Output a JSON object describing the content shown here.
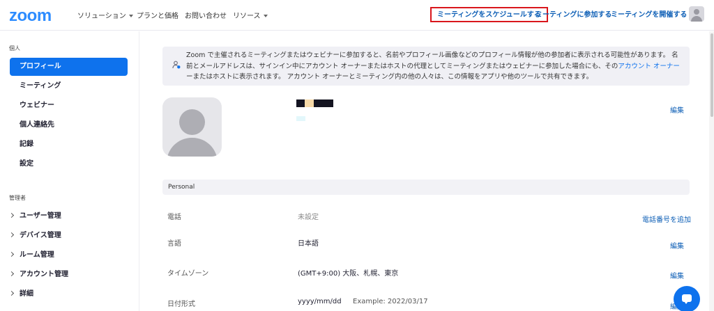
{
  "header": {
    "logo": "zoom",
    "nav": [
      {
        "label": "ソリューション"
      },
      {
        "label": "プランと価格"
      },
      {
        "label": "お問い合わせ"
      },
      {
        "label": "リソース"
      }
    ],
    "schedule_meeting": "ミーティングをスケジュールする",
    "join_meeting": "ミーティングに参加する",
    "host_meeting": "ミーティングを開催する"
  },
  "sidebar": {
    "personal_label": "個人",
    "items": [
      {
        "label": "プロフィール"
      },
      {
        "label": "ミーティング"
      },
      {
        "label": "ウェビナー"
      },
      {
        "label": "個人連絡先"
      },
      {
        "label": "記録"
      },
      {
        "label": "設定"
      }
    ],
    "admin_label": "管理者",
    "admin_items": [
      {
        "label": "ユーザー管理"
      },
      {
        "label": "デバイス管理"
      },
      {
        "label": "ルーム管理"
      },
      {
        "label": "アカウント管理"
      },
      {
        "label": "詳細"
      }
    ]
  },
  "notice": {
    "text_before": "Zoom で主催されるミーティングまたはウェビナーに参加すると、名前やプロフィール画像などのプロフィール情報が他の参加者に表示される可能性があります。 名前とメールアドレスは、サインイン中にアカウント オーナーまたはホストの代理としてミーティングまたはウェビナーに参加した場合にも、その",
    "link": "アカウント オーナー",
    "text_after": "ーまたはホストに表示されます。 アカウント オーナーとミーティング内の他の人々は、この情報をアプリや他のツールで共有できます。"
  },
  "profile": {
    "edit": "編集"
  },
  "personal_section": {
    "title": "Personal",
    "rows": [
      {
        "label": "電話",
        "value": "未設定",
        "action": "電話番号を追加"
      },
      {
        "label": "言語",
        "value": "日本語",
        "action": "編集"
      },
      {
        "label": "タイムゾーン",
        "value": "(GMT+9:00) 大阪、札幌、東京",
        "action": "編集"
      },
      {
        "label": "日付形式",
        "value": "yyyy/mm/dd",
        "example": "Example: 2022/03/17",
        "action": "編集"
      }
    ]
  },
  "colors": {
    "brand": "#2D8CFF",
    "primary": "#0E72ED",
    "link": "#0E5FB6",
    "highlight_border": "#d9161c"
  },
  "icons": {
    "notice": "person-info-icon",
    "chat": "chat-bubble-icon"
  }
}
